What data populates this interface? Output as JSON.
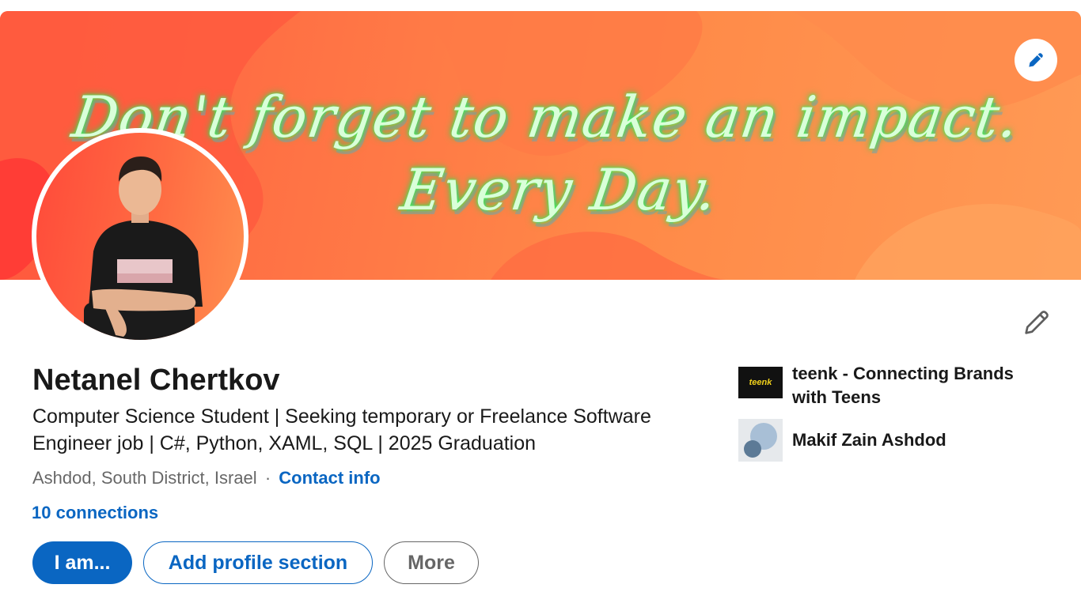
{
  "banner": {
    "quote_line1": "Don't forget to make an impact.",
    "quote_line2": "Every Day."
  },
  "profile": {
    "name": "Netanel Chertkov",
    "headline": "Computer Science Student | Seeking temporary or Freelance Software Engineer job | C#, Python, XAML, SQL | 2025 Graduation",
    "location": "Ashdod, South District, Israel",
    "separator": "·",
    "contact_info": "Contact info",
    "connections": "10 connections"
  },
  "actions": {
    "primary": "I am...",
    "add_section": "Add profile section",
    "more": "More"
  },
  "affiliations": [
    {
      "name": "teenk - Connecting Brands with Teens",
      "logo_text": "teenk"
    },
    {
      "name": "Makif Zain Ashdod"
    }
  ],
  "colors": {
    "accent": "#0a66c2",
    "banner_start": "#ff5c40",
    "banner_end": "#ff9a55",
    "neon_text": "#d9ffd9"
  }
}
